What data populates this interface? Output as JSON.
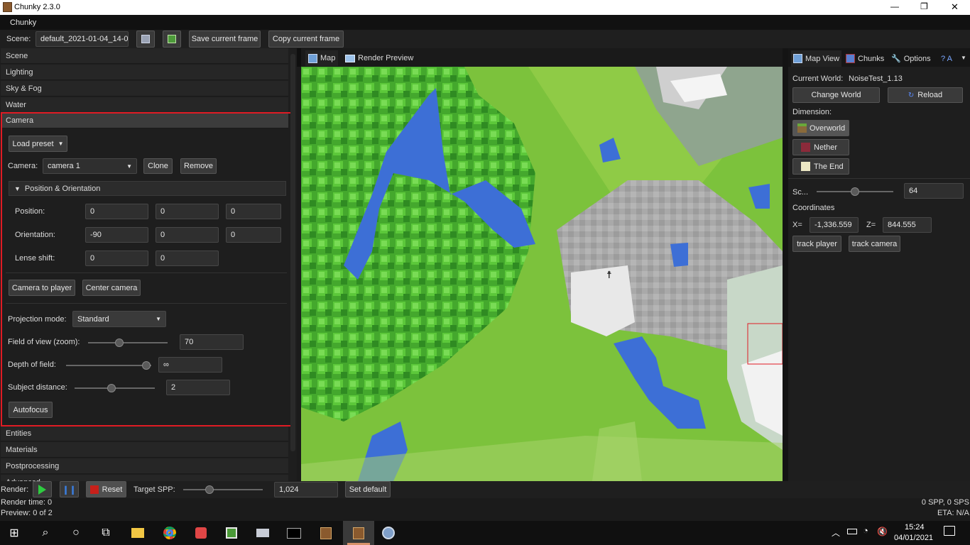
{
  "window": {
    "title": "Chunky 2.3.0",
    "minimize_glyph": "—",
    "maximize_glyph": "❐",
    "close_glyph": "✕"
  },
  "menu": {
    "chunky": "Chunky"
  },
  "toolbar": {
    "scene_label": "Scene:",
    "scene_value": "default_2021-01-04_14-0:",
    "save_frame": "Save current frame",
    "copy_frame": "Copy current frame"
  },
  "accordion": {
    "scene": "Scene",
    "lighting": "Lighting",
    "sky_fog": "Sky & Fog",
    "water": "Water",
    "camera": "Camera",
    "entities": "Entities",
    "materials": "Materials",
    "postprocessing": "Postprocessing",
    "advanced": "Advanced"
  },
  "camera": {
    "load_preset": "Load preset",
    "camera_label": "Camera:",
    "camera_value": "camera 1",
    "clone": "Clone",
    "remove": "Remove",
    "pos_orient_header": "Position & Orientation",
    "position_label": "Position:",
    "position": [
      "0",
      "0",
      "0"
    ],
    "orientation_label": "Orientation:",
    "orientation": [
      "-90",
      "0",
      "0"
    ],
    "lens_shift_label": "Lense shift:",
    "lens_shift": [
      "0",
      "0"
    ],
    "camera_to_player": "Camera to player",
    "center_camera": "Center camera",
    "projection_label": "Projection mode:",
    "projection_value": "Standard",
    "fov_label": "Field of view (zoom):",
    "fov_value": "70",
    "dof_label": "Depth of field:",
    "dof_value": "∞",
    "subject_label": "Subject distance:",
    "subject_value": "2",
    "autofocus": "Autofocus"
  },
  "center_tabs": {
    "map": "Map",
    "render_preview": "Render Preview"
  },
  "right_panel": {
    "tabs": {
      "map_view": "Map View",
      "chunks": "Chunks",
      "options": "Options",
      "help": "? A"
    },
    "current_world_label": "Current World:",
    "current_world_value": "NoiseTest_1.13",
    "change_world": "Change World",
    "reload": "Reload",
    "dimension_label": "Dimension:",
    "overworld": "Overworld",
    "nether": "Nether",
    "the_end": "The End",
    "scale_label": "Sc...",
    "scale_value": "64",
    "coordinates_label": "Coordinates",
    "x_label": "X=",
    "x_value": "-1,336.559",
    "z_label": "Z=",
    "z_value": "844.555",
    "track_player": "track player",
    "track_camera": "track camera"
  },
  "render_bar": {
    "render_label": "Render:",
    "reset": "Reset",
    "target_spp_label": "Target SPP:",
    "target_spp_value": "1,024",
    "set_default": "Set default",
    "render_time": "Render time: 0",
    "preview": "Preview: 0 of 2",
    "spp": "0 SPP, 0 SPS",
    "eta": "ETA: N/A"
  },
  "taskbar": {
    "time": "15:24",
    "date": "04/01/2021"
  },
  "colors": {
    "selection": "#e01b24",
    "water": "#3d6fd6",
    "grass": "#7bc33c",
    "tree": "#3fae2a",
    "stone": "#a8a8a8"
  }
}
